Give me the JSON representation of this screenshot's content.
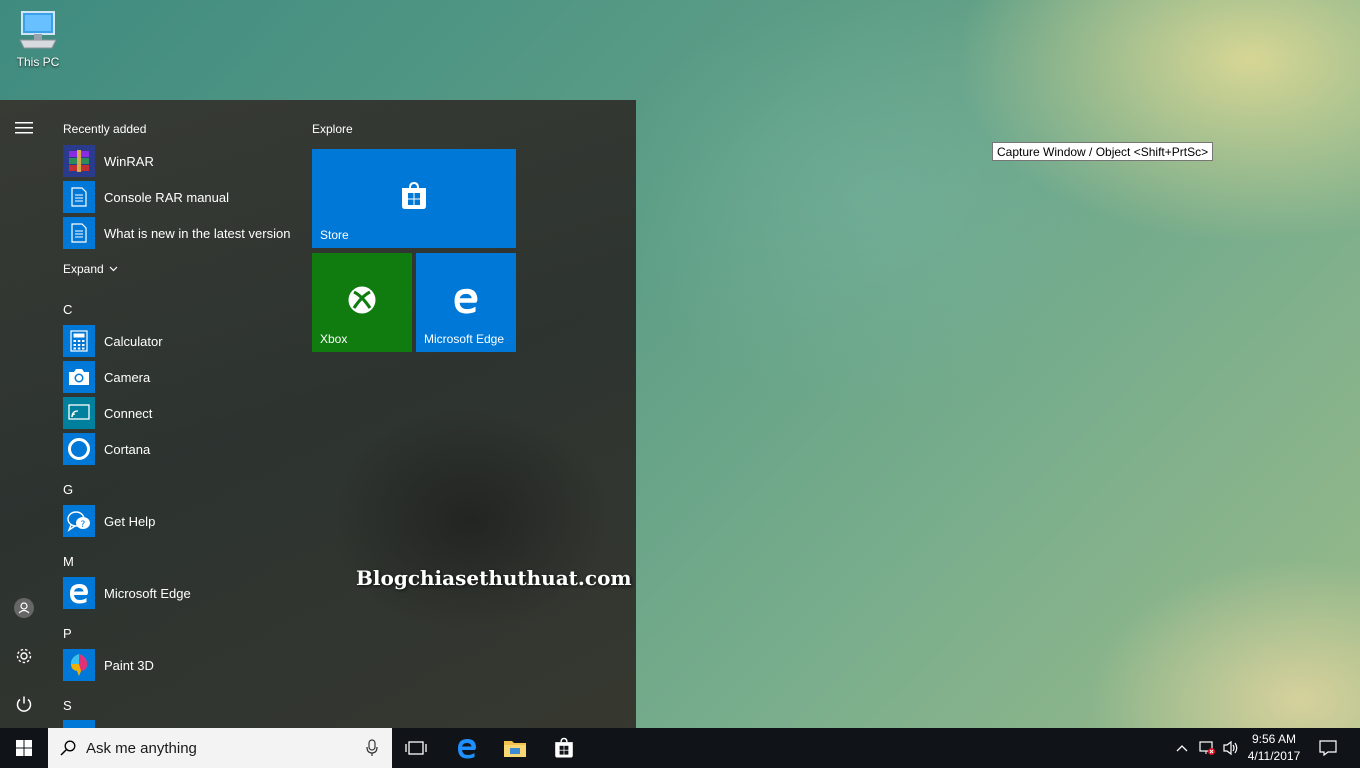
{
  "desktop": {
    "icon_label": "This PC",
    "tooltip": "Capture Window / Object <Shift+PrtSc>",
    "watermark": "Blogchiasethuthuat.com"
  },
  "start_menu": {
    "recently_added_title": "Recently added",
    "recently_added": [
      {
        "label": "WinRAR",
        "icon": "winrar-icon"
      },
      {
        "label": "Console RAR manual",
        "icon": "document-icon"
      },
      {
        "label": "What is new in the latest version",
        "icon": "document-icon"
      }
    ],
    "expand_label": "Expand",
    "groups": [
      {
        "letter": "C",
        "items": [
          {
            "label": "Calculator",
            "icon": "calculator-icon"
          },
          {
            "label": "Camera",
            "icon": "camera-icon"
          },
          {
            "label": "Connect",
            "icon": "connect-icon"
          },
          {
            "label": "Cortana",
            "icon": "cortana-icon"
          }
        ]
      },
      {
        "letter": "G",
        "items": [
          {
            "label": "Get Help",
            "icon": "help-icon"
          }
        ]
      },
      {
        "letter": "M",
        "items": [
          {
            "label": "Microsoft Edge",
            "icon": "edge-icon"
          }
        ]
      },
      {
        "letter": "P",
        "items": [
          {
            "label": "Paint 3D",
            "icon": "paint3d-icon"
          }
        ]
      },
      {
        "letter": "S",
        "items": []
      }
    ],
    "explore_title": "Explore",
    "tiles": [
      {
        "label": "Store",
        "color": "#0078d7"
      },
      {
        "label": "Xbox",
        "color": "#107c10"
      },
      {
        "label": "Microsoft Edge",
        "color": "#0078d7"
      }
    ]
  },
  "taskbar": {
    "search_placeholder": "Ask me anything",
    "time": "9:56 AM",
    "date": "4/11/2017"
  }
}
